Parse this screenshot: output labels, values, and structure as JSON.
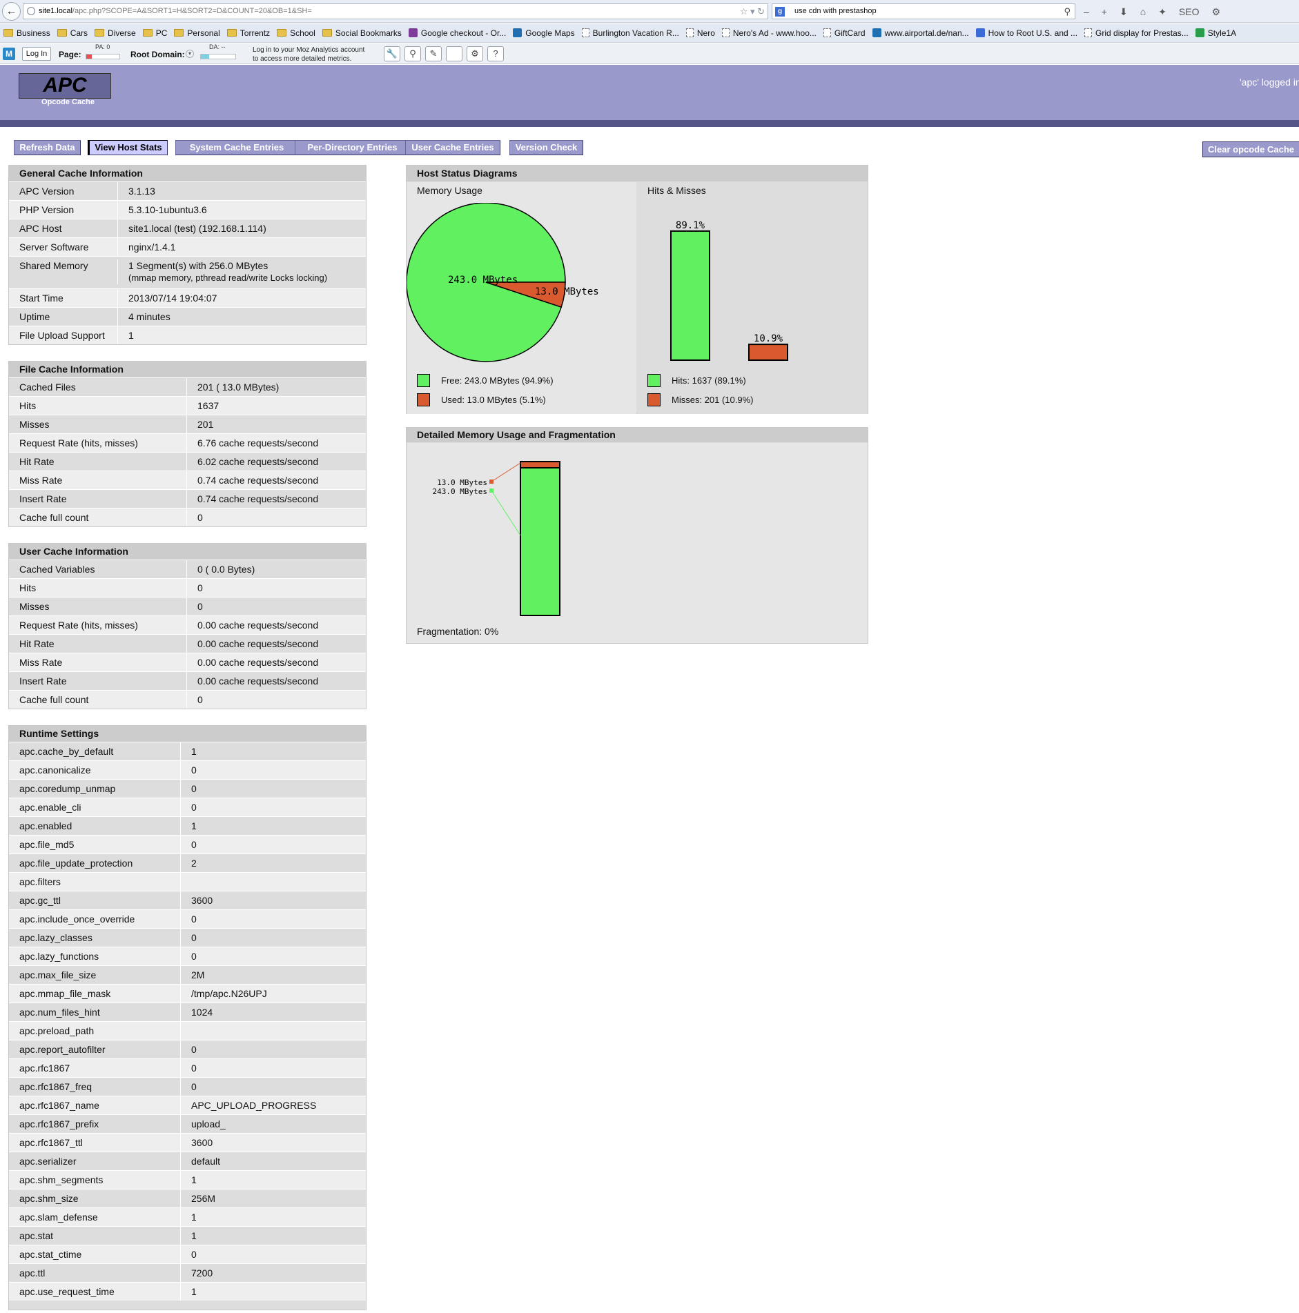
{
  "browser": {
    "url_host": "site1.local",
    "url_path": "/apc.php?SCOPE=A&SORT1=H&SORT2=D&COUNT=20&OB=1&SH=",
    "search_text": "use cdn with prestashop"
  },
  "bookmarks": [
    {
      "label": "Business",
      "icon": "folder"
    },
    {
      "label": "Cars",
      "icon": "folder"
    },
    {
      "label": "Diverse",
      "icon": "folder"
    },
    {
      "label": "PC",
      "icon": "folder"
    },
    {
      "label": "Personal",
      "icon": "folder"
    },
    {
      "label": "Torrentz",
      "icon": "folder"
    },
    {
      "label": "School",
      "icon": "folder"
    },
    {
      "label": "Social Bookmarks",
      "icon": "folder"
    },
    {
      "label": "Google checkout - Or...",
      "icon": "site"
    },
    {
      "label": "Google Maps",
      "icon": "site"
    },
    {
      "label": "Burlington Vacation R...",
      "icon": "page"
    },
    {
      "label": "Nero",
      "icon": "page"
    },
    {
      "label": "Nero's Ad - www.hoo...",
      "icon": "page"
    },
    {
      "label": "GiftCard",
      "icon": "page"
    },
    {
      "label": "www.airportal.de/nan...",
      "icon": "site"
    },
    {
      "label": "How to Root U.S. and ...",
      "icon": "site"
    },
    {
      "label": "Grid display for Prestas...",
      "icon": "page"
    },
    {
      "label": "Style1A",
      "icon": "site"
    }
  ],
  "mozbar": {
    "login": "Log In",
    "page_label": "Page:",
    "pa": "PA: 0",
    "root_label": "Root Domain:",
    "da": "DA: --",
    "note_line1": "Log in to your Moz Analytics account",
    "note_line2": "to access more detailed metrics."
  },
  "apc": {
    "logo": "APC",
    "logo_sub": "Opcode Cache",
    "logged": "'apc' logged in"
  },
  "tabs": [
    "Refresh Data",
    "View Host Stats",
    "System Cache Entries",
    "Per-Directory Entries",
    "User Cache Entries",
    "Version Check"
  ],
  "clear_button": "Clear opcode Cache",
  "general": {
    "title": "General Cache Information",
    "rows": [
      {
        "k": "APC Version",
        "v": "3.1.13"
      },
      {
        "k": "PHP Version",
        "v": "5.3.10-1ubuntu3.6"
      },
      {
        "k": "APC Host",
        "v": "site1.local (test) (192.168.1.114)"
      },
      {
        "k": "Server Software",
        "v": "nginx/1.4.1"
      },
      {
        "k": "Shared Memory",
        "v": "1 Segment(s) with 256.0 MBytes",
        "v2": "(mmap memory, pthread read/write Locks locking)"
      },
      {
        "k": "Start Time",
        "v": "2013/07/14 19:04:07"
      },
      {
        "k": "Uptime",
        "v": "4 minutes"
      },
      {
        "k": "File Upload Support",
        "v": "1"
      }
    ]
  },
  "file_cache": {
    "title": "File Cache Information",
    "rows": [
      {
        "k": "Cached Files",
        "v": "201 ( 13.0 MBytes)"
      },
      {
        "k": "Hits",
        "v": "1637"
      },
      {
        "k": "Misses",
        "v": "201"
      },
      {
        "k": "Request Rate (hits, misses)",
        "v": "6.76 cache requests/second"
      },
      {
        "k": "Hit Rate",
        "v": "6.02 cache requests/second"
      },
      {
        "k": "Miss Rate",
        "v": "0.74 cache requests/second"
      },
      {
        "k": "Insert Rate",
        "v": "0.74 cache requests/second"
      },
      {
        "k": "Cache full count",
        "v": "0"
      }
    ]
  },
  "user_cache": {
    "title": "User Cache Information",
    "rows": [
      {
        "k": "Cached Variables",
        "v": "0 ( 0.0 Bytes)"
      },
      {
        "k": "Hits",
        "v": "0"
      },
      {
        "k": "Misses",
        "v": "0"
      },
      {
        "k": "Request Rate (hits, misses)",
        "v": "0.00 cache requests/second"
      },
      {
        "k": "Hit Rate",
        "v": "0.00 cache requests/second"
      },
      {
        "k": "Miss Rate",
        "v": "0.00 cache requests/second"
      },
      {
        "k": "Insert Rate",
        "v": "0.00 cache requests/second"
      },
      {
        "k": "Cache full count",
        "v": "0"
      }
    ]
  },
  "runtime": {
    "title": "Runtime Settings",
    "rows": [
      {
        "k": "apc.cache_by_default",
        "v": "1"
      },
      {
        "k": "apc.canonicalize",
        "v": "0"
      },
      {
        "k": "apc.coredump_unmap",
        "v": "0"
      },
      {
        "k": "apc.enable_cli",
        "v": "0"
      },
      {
        "k": "apc.enabled",
        "v": "1"
      },
      {
        "k": "apc.file_md5",
        "v": "0"
      },
      {
        "k": "apc.file_update_protection",
        "v": "2"
      },
      {
        "k": "apc.filters",
        "v": ""
      },
      {
        "k": "apc.gc_ttl",
        "v": "3600"
      },
      {
        "k": "apc.include_once_override",
        "v": "0"
      },
      {
        "k": "apc.lazy_classes",
        "v": "0"
      },
      {
        "k": "apc.lazy_functions",
        "v": "0"
      },
      {
        "k": "apc.max_file_size",
        "v": "2M"
      },
      {
        "k": "apc.mmap_file_mask",
        "v": "/tmp/apc.N26UPJ"
      },
      {
        "k": "apc.num_files_hint",
        "v": "1024"
      },
      {
        "k": "apc.preload_path",
        "v": ""
      },
      {
        "k": "apc.report_autofilter",
        "v": "0"
      },
      {
        "k": "apc.rfc1867",
        "v": "0"
      },
      {
        "k": "apc.rfc1867_freq",
        "v": "0"
      },
      {
        "k": "apc.rfc1867_name",
        "v": "APC_UPLOAD_PROGRESS"
      },
      {
        "k": "apc.rfc1867_prefix",
        "v": "upload_"
      },
      {
        "k": "apc.rfc1867_ttl",
        "v": "3600"
      },
      {
        "k": "apc.serializer",
        "v": "default"
      },
      {
        "k": "apc.shm_segments",
        "v": "1"
      },
      {
        "k": "apc.shm_size",
        "v": "256M"
      },
      {
        "k": "apc.slam_defense",
        "v": "1"
      },
      {
        "k": "apc.stat",
        "v": "1"
      },
      {
        "k": "apc.stat_ctime",
        "v": "0"
      },
      {
        "k": "apc.ttl",
        "v": "7200"
      },
      {
        "k": "apc.use_request_time",
        "v": "1"
      }
    ]
  },
  "host_status": {
    "title": "Host Status Diagrams",
    "memory_label": "Memory Usage",
    "hits_label": "Hits & Misses",
    "legend_free": "Free: 243.0 MBytes (94.9%)",
    "legend_used": "Used: 13.0 MBytes (5.1%)",
    "legend_hits": "Hits: 1637 (89.1%)",
    "legend_misses": "Misses: 201 (10.9%)"
  },
  "detailed": {
    "title": "Detailed Memory Usage and Fragmentation",
    "fragmentation": "Fragmentation: 0%"
  },
  "colors": {
    "free": "#60f060",
    "used": "#d85a2e"
  },
  "chart_data": [
    {
      "type": "pie",
      "labels": [
        "243.0 MBytes",
        "13.0 MBytes"
      ],
      "values": [
        243.0,
        13.0
      ],
      "colors": [
        "#60f060",
        "#d85a2e"
      ]
    },
    {
      "type": "bar",
      "categories": [
        "Hits",
        "Misses"
      ],
      "values": [
        89.1,
        10.9
      ],
      "value_labels": [
        "89.1%",
        "10.9%"
      ],
      "colors": [
        "#60f060",
        "#d85a2e"
      ],
      "ylim": [
        0,
        100
      ]
    },
    {
      "type": "bar",
      "categories": [
        "Memory"
      ],
      "stacked": true,
      "series": [
        {
          "label": "13.0 MBytes",
          "value": 13.0,
          "color": "#d85a2e"
        },
        {
          "label": "243.0 MBytes",
          "value": 243.0,
          "color": "#60f060"
        }
      ]
    }
  ]
}
